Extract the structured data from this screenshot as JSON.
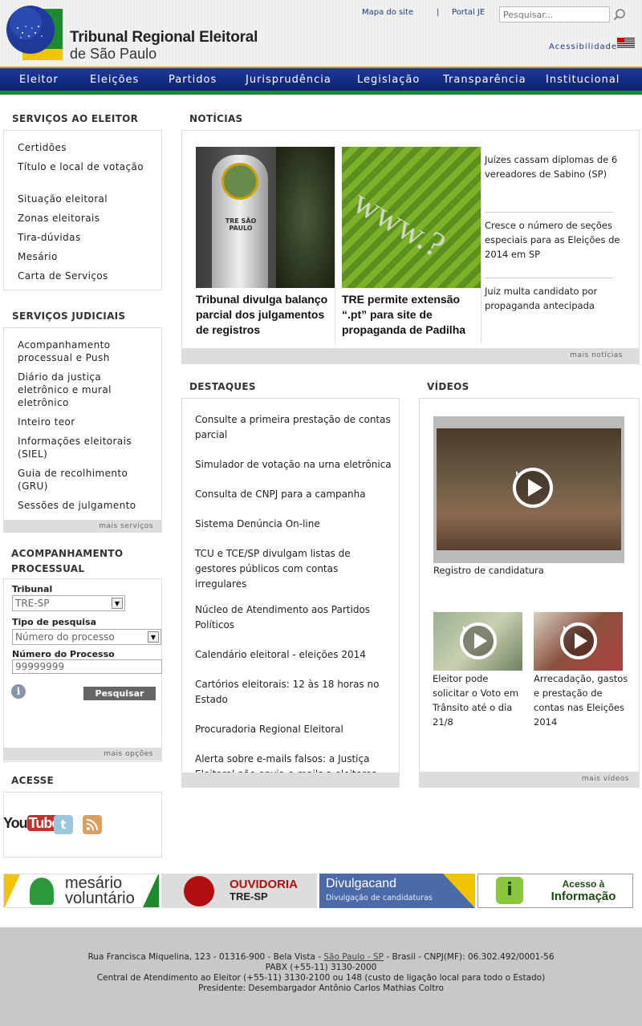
{
  "header": {
    "title": "Tribunal Regional Eleitoral",
    "subtitle": "de São Paulo",
    "links": [
      "Mapa do site",
      "|",
      "Portal JE"
    ],
    "search_placeholder": "Pesquisar...",
    "accessibility": "Acessibilidade"
  },
  "nav": [
    "Eleitor",
    "Eleições",
    "Partidos",
    "Jurisprudência",
    "Legislação",
    "Transparência",
    "Institucional"
  ],
  "servicos_eleitor": {
    "title": "SERVIÇOS AO ELEITOR",
    "items": [
      "Certidões",
      "Título e local de votação",
      "Situação eleitoral",
      "Zonas eleitorais",
      "Tira-dúvidas",
      "Mesário",
      "Carta de Serviços"
    ]
  },
  "servicos_judiciais": {
    "title": "SERVIÇOS JUDICIAIS",
    "items": [
      "Acompanhamento processual e Push",
      "Diário da justiça eletrônico e mural eletrônico",
      "Inteiro teor",
      "Informações eleitorais (SIEL)",
      "Guia de recolhimento (GRU)",
      "Sessões de julgamento"
    ],
    "more": "mais serviços"
  },
  "acompanhamento": {
    "title": "ACOMPANHAMENTO PROCESSUAL",
    "tribunal_label": "Tribunal",
    "tribunal_value": "TRE-SP",
    "tipo_label": "Tipo de pesquisa",
    "tipo_value": "Número do processo",
    "numero_label": "Número do Processo",
    "numero_value": "99999999",
    "submit": "Pesquisar",
    "more": "mais opções"
  },
  "acesse": {
    "title": "ACESSE",
    "youtube_a": "You",
    "youtube_b": "Tube"
  },
  "noticias": {
    "title": "NOTÍCIAS",
    "main": [
      {
        "caption": "Tribunal divulga balanço parcial dos julgamentos de registros",
        "sign": "TRE SÃO PAULO"
      },
      {
        "caption": "TRE permite extensão “.pt” para site de propaganda de Padilha",
        "www": "www.?"
      }
    ],
    "side": [
      "Juízes cassam diplomas de 6 vereadores de Sabino (SP)",
      "Cresce o número de seções especiais para as Eleições de 2014 em SP",
      "Juiz multa candidato por propaganda antecipada"
    ],
    "more": "mais notícias"
  },
  "destaques": {
    "title": "DESTAQUES",
    "items": [
      "Consulte a primeira prestação de contas parcial",
      "Simulador de votação na urna eletrônica",
      "Consulta de CNPJ para a campanha",
      "Sistema Denúncia On-line",
      "TCU e TCE/SP divulgam listas de gestores públicos com contas irregulares",
      "Núcleo de Atendimento aos Partidos Políticos",
      "Calendário eleitoral - eleições 2014",
      "Cartórios eleitorais: 12 às 18 horas no Estado",
      "Procuradoria Regional Eleitoral",
      "Alerta sobre e-mails falsos: a Justiça Eleitoral não envia e-mails a eleitores"
    ]
  },
  "videos": {
    "title": "VÍDEOS",
    "main_caption": "Registro de candidatura",
    "small": [
      "Eleitor pode solicitar o Voto em Trânsito até o dia 21/8",
      "Arrecadação, gastos e prestação de contas nas Eleições 2014"
    ],
    "more": "mais vídeos"
  },
  "banners": {
    "mesario_a": "mesário",
    "mesario_b": "voluntário",
    "ouvidoria_a": "OUVIDORIA",
    "ouvidoria_b": "TRE-SP",
    "divulga_a": "Divulgacand",
    "divulga_b": "Divulgação de candidaturas",
    "acesso_a": "Acesso à",
    "acesso_b": "Informação"
  },
  "footer": {
    "line1_pre": "Rua Francisca Miquelina, 123 - 01316-900 - Bela Vista - ",
    "line1_link": "São Paulo - SP",
    "line1_post": " - Brasil - CNPJ(MF): 06.302.492/0001-56",
    "line2": "PABX (+55-11) 3130-2000",
    "line3": "Central de Atendimento ao Eleitor (+55-11) 3130-2100 ou 148 (custo de ligação local para todo o Estado)",
    "line4": "Presidente: Desembargador Antônio Carlos Mathias Coltro"
  }
}
